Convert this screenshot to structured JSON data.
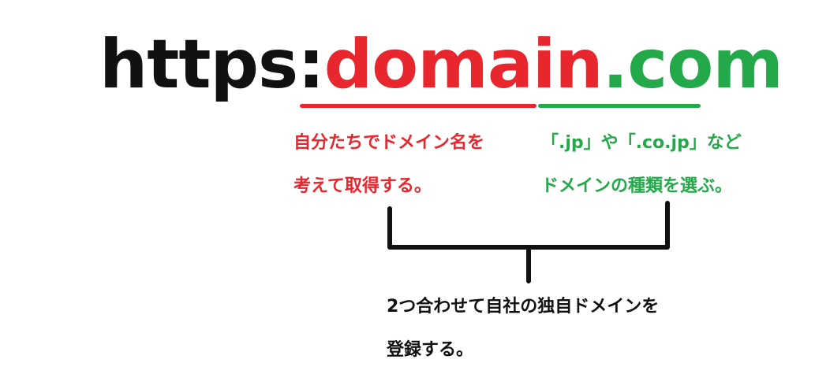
{
  "url": {
    "scheme": "https:",
    "domain": "domain",
    "tld": ".com"
  },
  "notes": {
    "domain_note": {
      "line1": "自分たちでドメイン名を",
      "line2": "考えて取得する。"
    },
    "tld_note": {
      "line1": "「.jp」や「.co.jp」など",
      "line2": "ドメインの種類を選ぶ。"
    },
    "combined_note": {
      "line1": "2つ合わせて自社の独自ドメインを",
      "line2": "登録する。"
    }
  },
  "colors": {
    "domain": "#e8262e",
    "tld": "#23a84a",
    "text": "#111111"
  }
}
